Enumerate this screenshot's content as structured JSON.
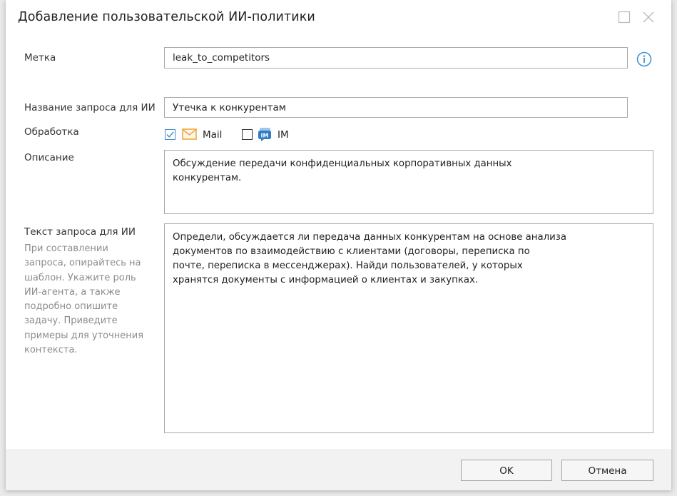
{
  "dialog": {
    "title": "Добавление пользовательской ИИ-политики"
  },
  "form": {
    "label_field": {
      "label": "Метка",
      "value": "leak_to_competitors"
    },
    "query_name": {
      "label": "Название запроса для ИИ",
      "value": "Утечка к конкурентам"
    },
    "processing": {
      "label": "Обработка",
      "options": [
        {
          "label": "Mail",
          "checked": true,
          "icon": "mail-envelope-icon"
        },
        {
          "label": "IM",
          "checked": false,
          "icon": "im-chat-icon"
        }
      ]
    },
    "description": {
      "label": "Описание",
      "lines": [
        "Обсуждение передачи конфиденциальных корпоративных данных",
        "конкурентам."
      ]
    },
    "query_text": {
      "label": "Текст запроса для ИИ",
      "hint_lines": [
        "При составлении",
        "запроса, опирайтесь на",
        "шаблон. Укажите роль",
        "ИИ-агента, а также",
        "подробно опишите",
        "задачу. Приведите",
        "примеры для уточнения",
        "контекста."
      ],
      "lines": [
        "Определи, обсуждается ли передача данных конкурентам на основе анализа",
        "документов по взаимодействию с клиентами (договоры, переписка по",
        "почте, переписка в мессенджерах). Найди пользователей, у которых",
        "хранятся документы с информацией о клиентах и закупках."
      ]
    }
  },
  "buttons": {
    "ok": "OK",
    "cancel": "Отмена"
  },
  "colors": {
    "accent": "#3f8fd2",
    "mail_icon": "#f0a640",
    "border": "#a9a9a9",
    "footer_bg": "#f2f2f2"
  },
  "icons": {
    "maximize": "maximize-icon",
    "close": "close-icon",
    "info": "info-icon"
  }
}
